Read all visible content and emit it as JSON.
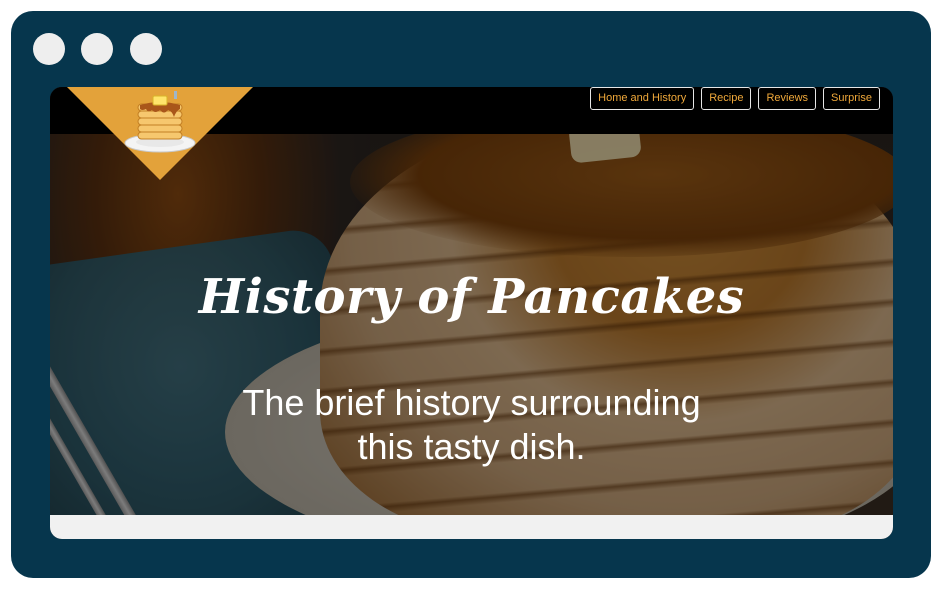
{
  "window": {
    "controls": [
      "window-dot",
      "window-dot",
      "window-dot"
    ]
  },
  "nav": {
    "links": [
      "Home and History",
      "Recipe",
      "Reviews",
      "Surprise"
    ]
  },
  "hero": {
    "title": "History of Pancakes",
    "subtitle_line1": "The brief history surrounding",
    "subtitle_line2": "this tasty dish."
  },
  "colors": {
    "frame": "#06364d",
    "navbar": "#000000",
    "nav_link_text": "#f0a83a",
    "logo_triangle": "#e3a23a"
  },
  "icons": {
    "logo": "pancake-stack-icon"
  }
}
